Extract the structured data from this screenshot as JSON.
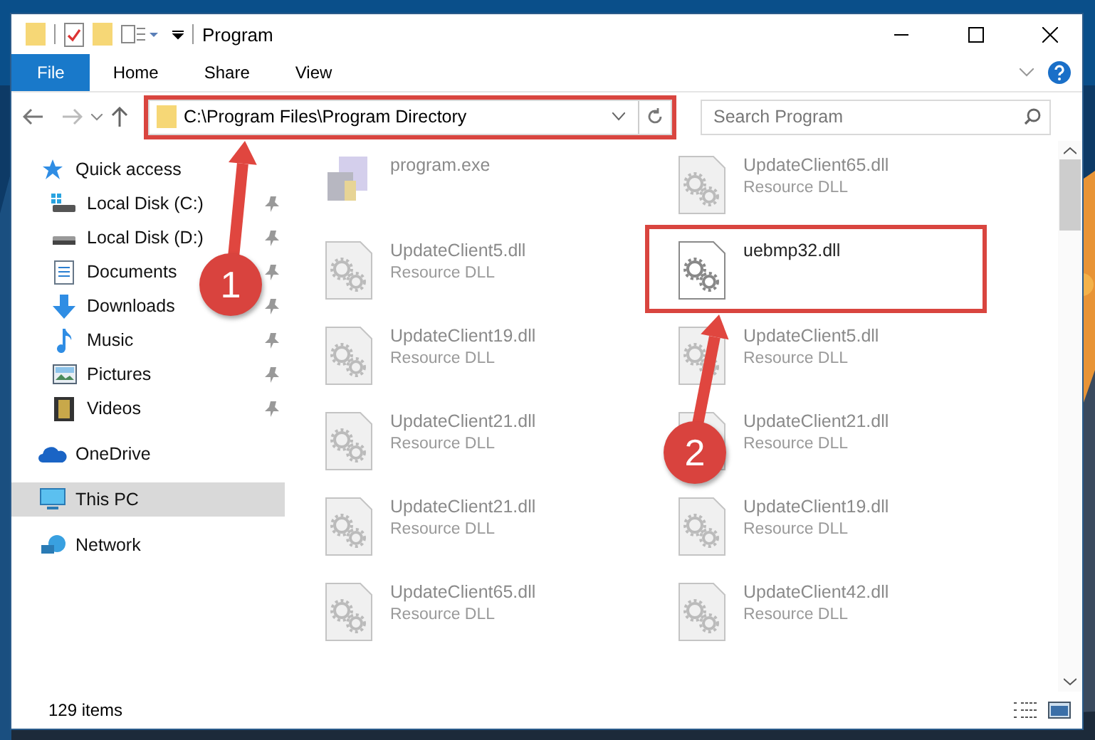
{
  "window": {
    "title": "Program"
  },
  "ribbon": {
    "tabs": [
      {
        "label": "File",
        "kind": "file",
        "selected": false
      },
      {
        "label": "Home",
        "kind": "tab",
        "selected": false
      },
      {
        "label": "Share",
        "kind": "tab",
        "selected": false
      },
      {
        "label": "View",
        "kind": "tab",
        "selected": false
      }
    ]
  },
  "address": {
    "path": "C:\\Program Files\\Program Directory",
    "search_placeholder": "Search Program"
  },
  "sidebar": {
    "items": [
      {
        "label": "Quick access",
        "selected": false,
        "children": [
          {
            "label": "Local Disk (C:)",
            "pinned": true,
            "selected": false
          },
          {
            "label": "Local Disk (D:)",
            "pinned": true,
            "selected": false
          },
          {
            "label": "Documents",
            "pinned": true,
            "selected": false
          },
          {
            "label": "Downloads",
            "pinned": true,
            "selected": false
          },
          {
            "label": "Music",
            "pinned": true,
            "selected": false
          },
          {
            "label": "Pictures",
            "pinned": true,
            "selected": false
          },
          {
            "label": "Videos",
            "pinned": true,
            "selected": false
          }
        ]
      },
      {
        "label": "OneDrive",
        "selected": false
      },
      {
        "label": "This PC",
        "selected": true
      },
      {
        "label": "Network",
        "selected": false
      }
    ]
  },
  "files": [
    {
      "name": "program.exe",
      "kind": "exe",
      "dimmed": true
    },
    {
      "name": "UpdateClient65.dll",
      "type": "Resource DLL",
      "kind": "dll",
      "dimmed": true
    },
    {
      "name": "UpdateClient5.dll",
      "type": "Resource DLL",
      "kind": "dll",
      "dimmed": true
    },
    {
      "name": "uebmp32.dll",
      "kind": "dll",
      "dimmed": false
    },
    {
      "name": "UpdateClient19.dll",
      "type": "Resource DLL",
      "kind": "dll",
      "dimmed": true
    },
    {
      "name": "UpdateClient5.dll",
      "type": "Resource DLL",
      "kind": "dll",
      "dimmed": true
    },
    {
      "name": "UpdateClient21.dll",
      "type": "Resource DLL",
      "kind": "dll",
      "dimmed": true
    },
    {
      "name": "UpdateClient21.dll",
      "type": "Resource DLL",
      "kind": "dll",
      "dimmed": true
    },
    {
      "name": "UpdateClient21.dll",
      "type": "Resource DLL",
      "kind": "dll",
      "dimmed": true
    },
    {
      "name": "UpdateClient19.dll",
      "type": "Resource DLL",
      "kind": "dll",
      "dimmed": true
    },
    {
      "name": "UpdateClient65.dll",
      "type": "Resource DLL",
      "kind": "dll",
      "dimmed": true
    },
    {
      "name": "UpdateClient42.dll",
      "type": "Resource DLL",
      "kind": "dll",
      "dimmed": true
    }
  ],
  "status_bar": {
    "item_count": "129 items"
  },
  "annotations": [
    {
      "label": "1"
    },
    {
      "label": "2"
    }
  ]
}
